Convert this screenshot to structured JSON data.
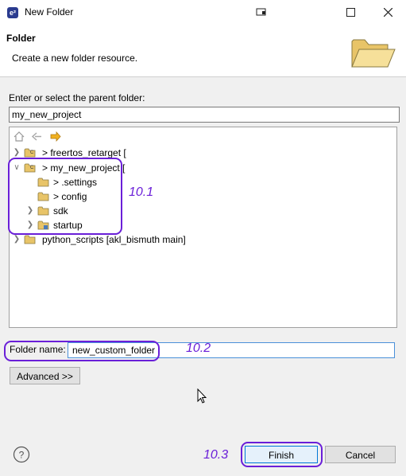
{
  "window": {
    "title": "New Folder",
    "app_icon": "e²"
  },
  "header": {
    "title": "Folder",
    "description": "Create a new folder resource."
  },
  "parent": {
    "label": "Enter or select the parent folder:",
    "value": "my_new_project"
  },
  "tree": {
    "items": [
      {
        "label": "> freertos_retarget [",
        "expanded": false,
        "level": 0
      },
      {
        "label": "> my_new_project [",
        "expanded": true,
        "level": 0
      },
      {
        "label": "> .settings",
        "level": 1
      },
      {
        "label": "> config",
        "level": 1
      },
      {
        "label": "sdk",
        "level": 1
      },
      {
        "label": "startup",
        "level": 1
      },
      {
        "label": "python_scripts [akl_bismuth main]",
        "expanded": false,
        "level": 0
      }
    ]
  },
  "folder_name": {
    "label": "Folder name:",
    "value": "new_custom_folder"
  },
  "buttons": {
    "advanced": "Advanced >>",
    "finish": "Finish",
    "cancel": "Cancel"
  },
  "annotations": {
    "a1": "10.1",
    "a2": "10.2",
    "a3": "10.3"
  },
  "colors": {
    "annotation": "#6a1fd8",
    "focus_border": "#4a90d9",
    "folder_yellow": "#e8c468"
  }
}
